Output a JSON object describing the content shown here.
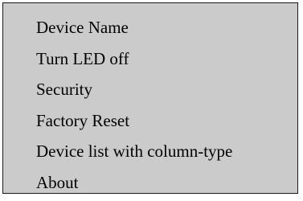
{
  "menu": {
    "items": [
      {
        "label": "Device Name"
      },
      {
        "label": "Turn LED off"
      },
      {
        "label": "Security"
      },
      {
        "label": "Factory Reset"
      },
      {
        "label": "Device list with column-type"
      },
      {
        "label": "About"
      }
    ]
  },
  "colors": {
    "menu_background": "#cbcbcb",
    "menu_border": "#1a1a1a",
    "text": "#000000"
  }
}
